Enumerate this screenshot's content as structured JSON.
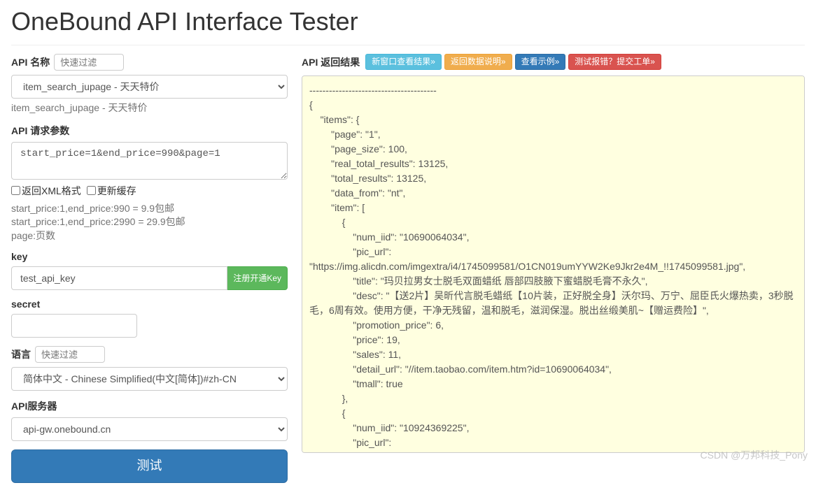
{
  "page_title": "OneBound API Interface Tester",
  "left": {
    "api_name_label": "API 名称",
    "api_name_filter_placeholder": "快速过滤",
    "api_select_value": "item_search_jupage - 天天特价",
    "api_help_text": "item_search_jupage - 天天特价",
    "api_params_label": "API 请求参数",
    "api_params_value": "start_price=1&end_price=990&page=1",
    "xml_checkbox_label": "返回XML格式",
    "cache_checkbox_label": "更新缓存",
    "params_help_line1": "start_price:1,end_price:990 = 9.9包邮",
    "params_help_line2": "start_price:1,end_price:2990 = 29.9包邮",
    "params_help_line3": "page:页数",
    "key_label": "key",
    "key_value": "test_api_key",
    "register_key_btn": "注册开通Key",
    "secret_label": "secret",
    "secret_value": "",
    "language_label": "语言",
    "language_filter_placeholder": "快速过滤",
    "language_select_value": "简体中文 - Chinese Simplified(中文[简体])#zh-CN",
    "api_server_label": "API服务器",
    "api_server_value": "api-gw.onebound.cn",
    "test_btn": "测试"
  },
  "right": {
    "result_label": "API 返回结果",
    "btn_new_window": "新窗口查看结果»",
    "btn_data_desc": "返回数据说明»",
    "btn_example": "查看示例»",
    "btn_report": "测试报错？提交工单»",
    "result_text": "---------------------------------------\n{\n    \"items\": {\n        \"page\": \"1\",\n        \"page_size\": 100,\n        \"real_total_results\": 13125,\n        \"total_results\": 13125,\n        \"data_from\": \"nt\",\n        \"item\": [\n            {\n                \"num_iid\": \"10690064034\",\n                \"pic_url\": \"https://img.alicdn.com/imgextra/i4/1745099581/O1CN019umYYW2Ke9Jkr2e4M_!!1745099581.jpg\",\n                \"title\": \"玛贝拉男女士脱毛双面蜡纸 唇部四肢腋下蜜蜡脱毛膏不永久\",\n                \"desc\": \"【送2片】吴昕代言脱毛蜡纸【10片装，正好脱全身】沃尔玛、万宁、屈臣氏火爆热卖，3秒脱毛，6周有效。使用方便，干净无残留，温和脱毛，滋润保湿。脱出丝缎美肌~【赠运费险】\",\n                \"promotion_price\": 6,\n                \"price\": 19,\n                \"sales\": 11,\n                \"detail_url\": \"//item.taobao.com/item.htm?id=10690064034\",\n                \"tmall\": true\n            },\n            {\n                \"num_iid\": \"10924369225\",\n                \"pic_url\":"
  },
  "watermark": "CSDN @万邦科技_Pony"
}
